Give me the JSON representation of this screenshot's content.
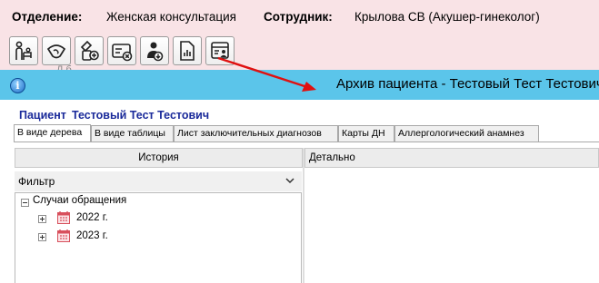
{
  "header": {
    "department_label": "Отделение:",
    "department_value": "Женская консультация",
    "employee_label": "Сотрудник:",
    "employee_value": "Крылова СВ (Акушер-гинеколог)",
    "partial_text": "Д                     б"
  },
  "toolbar": {
    "buttons": [
      "mother-child-icon",
      "ultrasound-icon",
      "prescription-add-icon",
      "id-card-remove-icon",
      "doctor-download-icon",
      "document-chart-icon",
      "patient-archive-icon"
    ]
  },
  "window": {
    "title": "Архив пациента - Тестовый Тест Тестович",
    "patient_label": "Пациент",
    "patient_name": "Тестовый Тест Тестович",
    "tabs": [
      {
        "label": "В виде дерева",
        "active": true
      },
      {
        "label": "В виде таблицы",
        "active": false
      },
      {
        "label": "Лист заключительных диагнозов",
        "active": false
      },
      {
        "label": "Карты ДН",
        "active": false
      },
      {
        "label": "Аллергологический анамнез",
        "active": false
      }
    ],
    "history_header": "История",
    "detail_header": "Детально",
    "filter_label": "Фильтр",
    "tree": {
      "root": "Случаи обращения",
      "children": [
        "2022 г.",
        "2023 г."
      ]
    }
  },
  "colors": {
    "topbar": "#f9e3e6",
    "titlebar": "#5bc5ea",
    "patient_text": "#1a2a9a",
    "arrow": "#e01010"
  }
}
